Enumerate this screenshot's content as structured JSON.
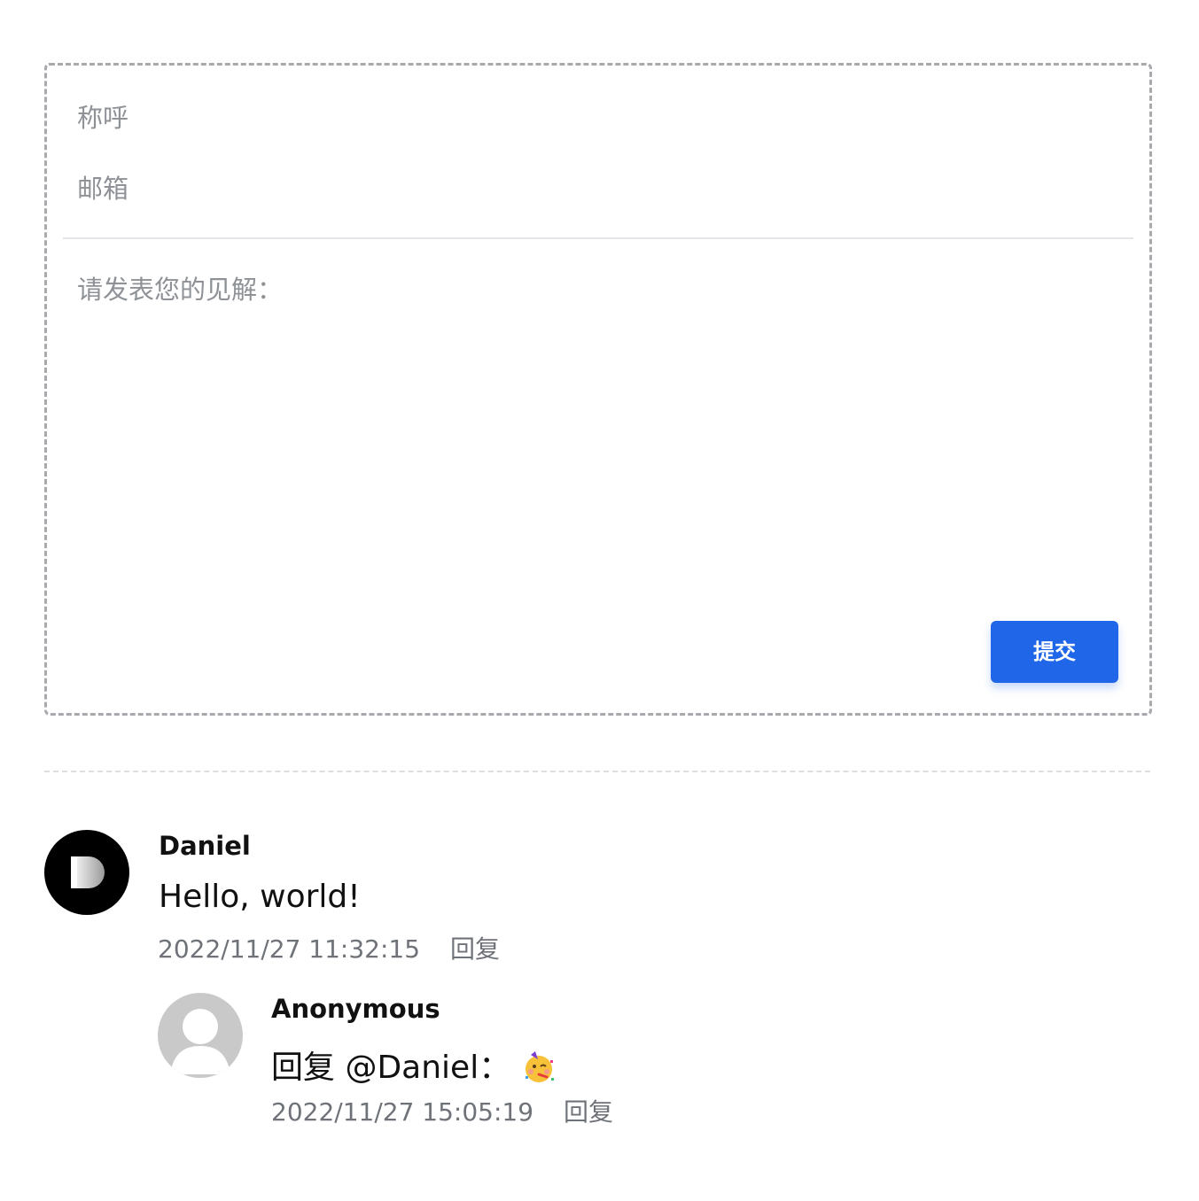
{
  "form": {
    "name_placeholder": "称呼",
    "email_placeholder": "邮箱",
    "comment_placeholder": "请发表您的见解：",
    "submit_label": "提交"
  },
  "comments": [
    {
      "author": "Daniel",
      "avatar_letter": "D",
      "content": "Hello, world!",
      "time": "2022/11/27 11:32:15",
      "reply_label": "回复"
    },
    {
      "author": "Anonymous",
      "content": "回复 @Daniel：",
      "emoji": "partying-face-icon",
      "time": "2022/11/27 15:05:19",
      "reply_label": "回复"
    }
  ],
  "colors": {
    "accent": "#2066e8",
    "placeholder": "#8e9297",
    "meta": "#6f7379",
    "border": "#a7a9ad"
  }
}
